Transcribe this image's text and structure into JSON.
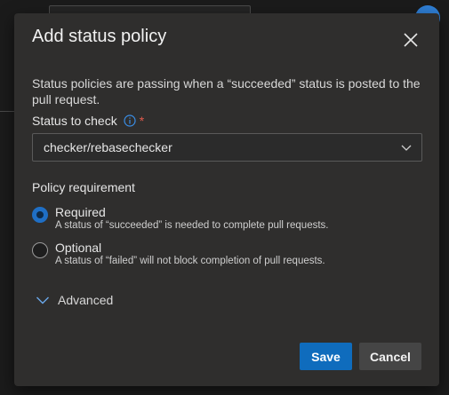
{
  "dialog": {
    "title": "Add status policy",
    "description": "Status policies are passing when a “succeeded” status is posted to the pull request.",
    "status_field": {
      "label": "Status to check",
      "required_marker": "*",
      "value": "checker/rebasechecker"
    },
    "policy_requirement": {
      "label": "Policy requirement",
      "options": [
        {
          "title": "Required",
          "description": "A status of “succeeded” is needed to complete pull requests.",
          "selected": true
        },
        {
          "title": "Optional",
          "description": "A status of “failed” will not block completion of pull requests.",
          "selected": false
        }
      ]
    },
    "advanced_label": "Advanced",
    "buttons": {
      "save": "Save",
      "cancel": "Cancel"
    }
  },
  "icons": {
    "close": "close-icon",
    "info": "info-icon",
    "chevron_down": "chevron-down-icon"
  },
  "colors": {
    "accent": "#0f6cbd",
    "required_star": "#e05a4c",
    "dialog_bg": "#2f2e2d"
  }
}
